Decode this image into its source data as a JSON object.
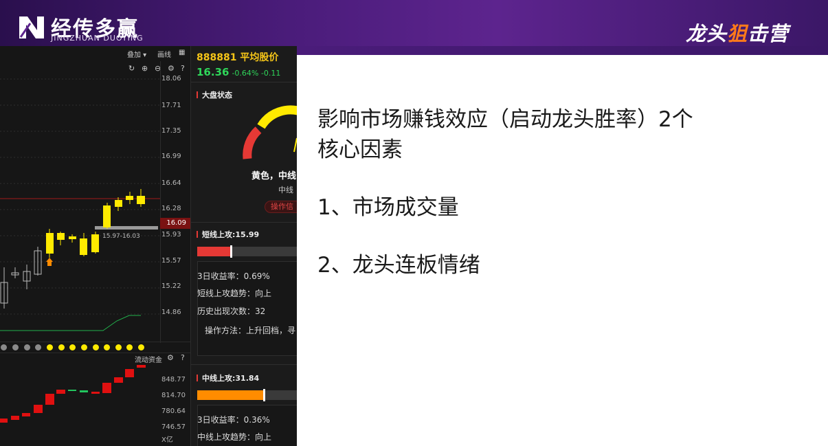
{
  "brand": {
    "logo_text": "经传多赢",
    "logo_sub": "JINGZHUAN DUOYING",
    "right_prefix": "龙头",
    "right_accent": "狙",
    "right_suffix": "击营"
  },
  "chart": {
    "toolbar": {
      "overlay_label": "叠加 ▾",
      "draw_label": "画线"
    },
    "price_axis_labels": [
      "18.06",
      "17.71",
      "17.35",
      "16.99",
      "16.64",
      "16.28",
      "15.93",
      "15.57",
      "15.22",
      "14.86"
    ],
    "current_price": "16.09",
    "range_label": "15.97-16.03",
    "flow": {
      "title": "流动资金",
      "axis_labels": [
        "848.77",
        "814.70",
        "780.64",
        "746.57"
      ],
      "unit": "X亿"
    },
    "colors": {
      "up": "#ffea00",
      "down": "#e01010",
      "flat": "#22c55e"
    }
  },
  "stock": {
    "code_name": "888881 平均股价",
    "price": "16.36",
    "change": "-0.64%  -0.11"
  },
  "market": {
    "title": "大盘状态",
    "gauge_text": "黄色，中线",
    "gauge_sub": "中线",
    "op_label": "操作信"
  },
  "short": {
    "title": "短线上攻:15.99",
    "fill_fraction": 0.33,
    "lines": [
      "3日收益率：0.69%",
      "短线上攻趋势：向上",
      "历史出现次数：32",
      "操作方法：上升回档，寻"
    ]
  },
  "mid": {
    "title": "中线上攻:31.84",
    "fill_fraction": 0.65,
    "lines": [
      "3日收益率：0.36%",
      "中线上攻趋势：向上"
    ]
  },
  "slide": {
    "heading_line1": "影响市场赚钱效应（启动龙头胜率）2个",
    "heading_line2": "核心因素",
    "point1": "1、市场成交量",
    "point2": "2、龙头连板情绪"
  }
}
